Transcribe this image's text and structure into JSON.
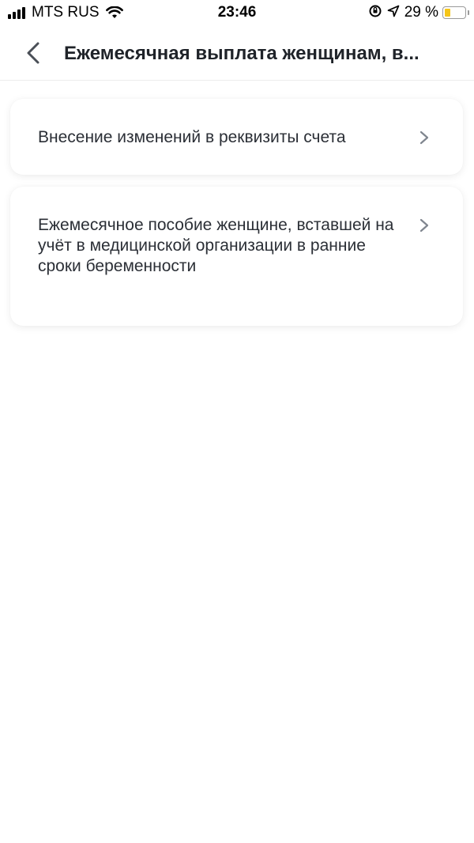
{
  "status_bar": {
    "carrier": "MTS RUS",
    "time": "23:46",
    "battery_percent": "29 %",
    "battery_level": 0.29,
    "battery_color": "#f5c518",
    "icons": [
      "signal-icon",
      "wifi-icon",
      "orientation-lock-icon",
      "location-arrow-icon",
      "battery-icon"
    ]
  },
  "header": {
    "back_icon": "chevron-left-icon",
    "title": "Ежемесячная выплата женщинам, в..."
  },
  "list": {
    "items": [
      {
        "label": "Внесение изменений в реквизиты счета",
        "icon": "chevron-right-icon"
      },
      {
        "label": "Ежемесячное пособие женщине, вставшей на учёт в медицинской организации в ранние сроки беременности",
        "icon": "chevron-right-icon"
      }
    ]
  }
}
